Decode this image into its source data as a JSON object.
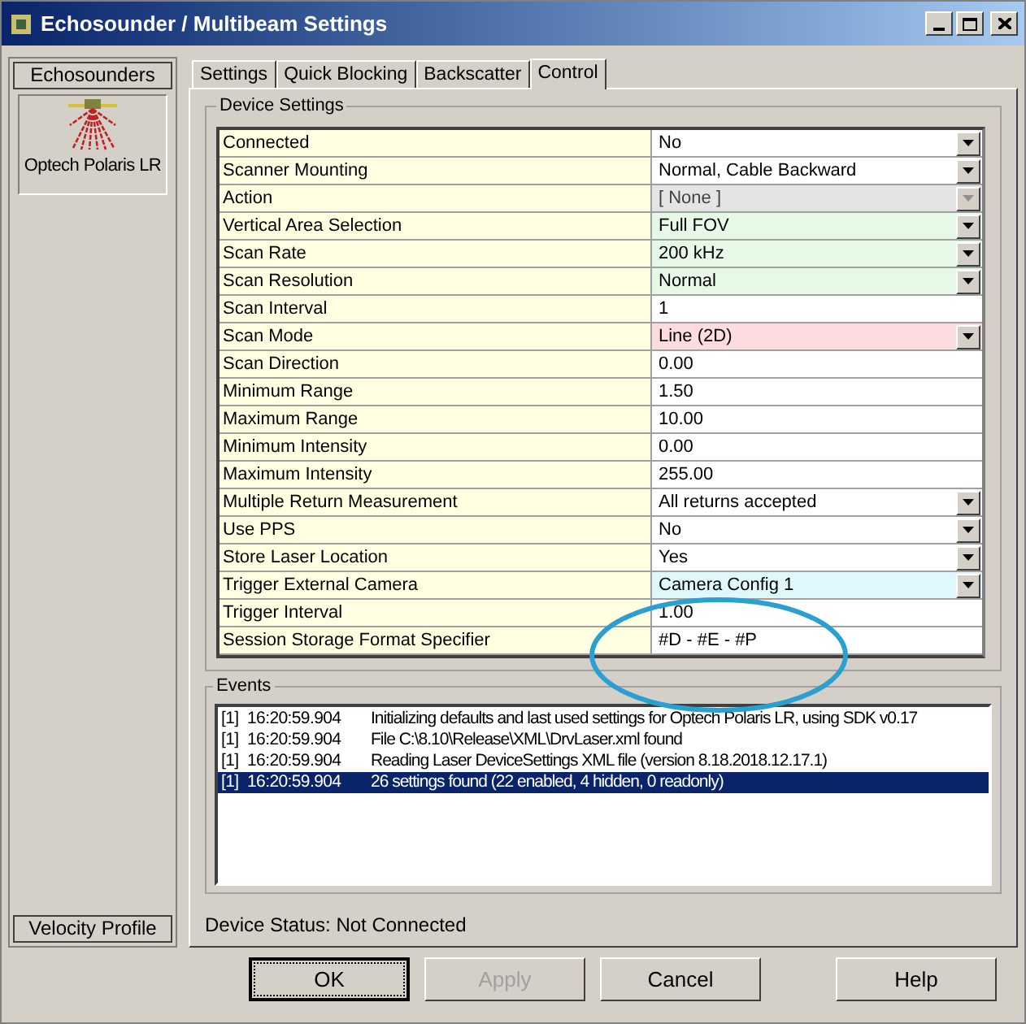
{
  "window": {
    "title": "Echosounder / Multibeam Settings"
  },
  "sidebar": {
    "header": "Echosounders",
    "items": [
      {
        "label": "Optech Polaris LR",
        "selected": false
      }
    ],
    "footer": "Velocity Profile"
  },
  "tabs": [
    {
      "label": "Settings",
      "selected": false
    },
    {
      "label": "Quick Blocking",
      "selected": false
    },
    {
      "label": "Backscatter",
      "selected": false
    },
    {
      "label": "Control",
      "selected": true
    }
  ],
  "device_settings": {
    "title": "Device Settings",
    "rows": [
      {
        "name": "Connected",
        "value": "No",
        "kind": "dropdown",
        "color": "#ffffff",
        "disabled": false
      },
      {
        "name": "Scanner Mounting",
        "value": "Normal, Cable Backward",
        "kind": "dropdown",
        "color": "#ffffff",
        "disabled": false
      },
      {
        "name": "Action",
        "value": "[ None ]",
        "kind": "dropdown",
        "color": "#e4e4e4",
        "disabled": true
      },
      {
        "name": "Vertical Area Selection",
        "value": "Full FOV",
        "kind": "dropdown",
        "color": "#e6f8e6",
        "disabled": false
      },
      {
        "name": "Scan Rate",
        "value": "200 kHz",
        "kind": "dropdown",
        "color": "#e6f8e6",
        "disabled": false
      },
      {
        "name": "Scan Resolution",
        "value": "Normal",
        "kind": "dropdown",
        "color": "#e6f8e6",
        "disabled": false
      },
      {
        "name": "Scan Interval",
        "value": "1",
        "kind": "text",
        "color": "#ffffff",
        "disabled": false
      },
      {
        "name": "Scan Mode",
        "value": "Line (2D)",
        "kind": "dropdown",
        "color": "#fcdcdc",
        "disabled": false
      },
      {
        "name": "Scan Direction",
        "value": "0.00",
        "kind": "text",
        "color": "#ffffff",
        "disabled": false
      },
      {
        "name": "Minimum Range",
        "value": "1.50",
        "kind": "text",
        "color": "#ffffff",
        "disabled": false
      },
      {
        "name": "Maximum Range",
        "value": "10.00",
        "kind": "text",
        "color": "#ffffff",
        "disabled": false
      },
      {
        "name": "Minimum Intensity",
        "value": "0.00",
        "kind": "text",
        "color": "#ffffff",
        "disabled": false
      },
      {
        "name": "Maximum Intensity",
        "value": "255.00",
        "kind": "text",
        "color": "#ffffff",
        "disabled": false
      },
      {
        "name": "Multiple Return Measurement",
        "value": "All returns accepted",
        "kind": "dropdown",
        "color": "#ffffff",
        "disabled": false
      },
      {
        "name": "Use PPS",
        "value": "No",
        "kind": "dropdown",
        "color": "#ffffff",
        "disabled": false
      },
      {
        "name": "Store Laser Location",
        "value": "Yes",
        "kind": "dropdown",
        "color": "#ffffff",
        "disabled": false
      },
      {
        "name": "Trigger External Camera",
        "value": "Camera Config 1",
        "kind": "dropdown",
        "color": "#dff8fc",
        "disabled": false
      },
      {
        "name": "Trigger Interval",
        "value": "1.00",
        "kind": "text",
        "color": "#ffffff",
        "disabled": false
      },
      {
        "name": "Session Storage Format Specifier",
        "value": "#D - #E - #P",
        "kind": "text",
        "color": "#ffffff",
        "disabled": false
      }
    ]
  },
  "events": {
    "title": "Events",
    "items": [
      {
        "source": "[1]",
        "time": "16:20:59.904",
        "message": "Initializing defaults and last used settings for Optech Polaris LR, using SDK v0.17",
        "selected": false
      },
      {
        "source": "[1]",
        "time": "16:20:59.904",
        "message": "File C:\\8.10\\Release\\XML\\DrvLaser.xml found",
        "selected": false
      },
      {
        "source": "[1]",
        "time": "16:20:59.904",
        "message": "Reading Laser DeviceSettings XML file (version 8.18.2018.12.17.1)",
        "selected": false
      },
      {
        "source": "[1]",
        "time": "16:20:59.904",
        "message": "26 settings found (22 enabled, 4 hidden, 0 readonly)",
        "selected": true
      }
    ]
  },
  "status_bar": "Device Status: Not Connected",
  "buttons": [
    {
      "label": "OK",
      "disabled": false,
      "focused": true
    },
    {
      "label": "Apply",
      "disabled": true,
      "focused": false
    },
    {
      "label": "Cancel",
      "disabled": false,
      "focused": false
    },
    {
      "label": "Help",
      "disabled": false,
      "focused": false
    }
  ]
}
